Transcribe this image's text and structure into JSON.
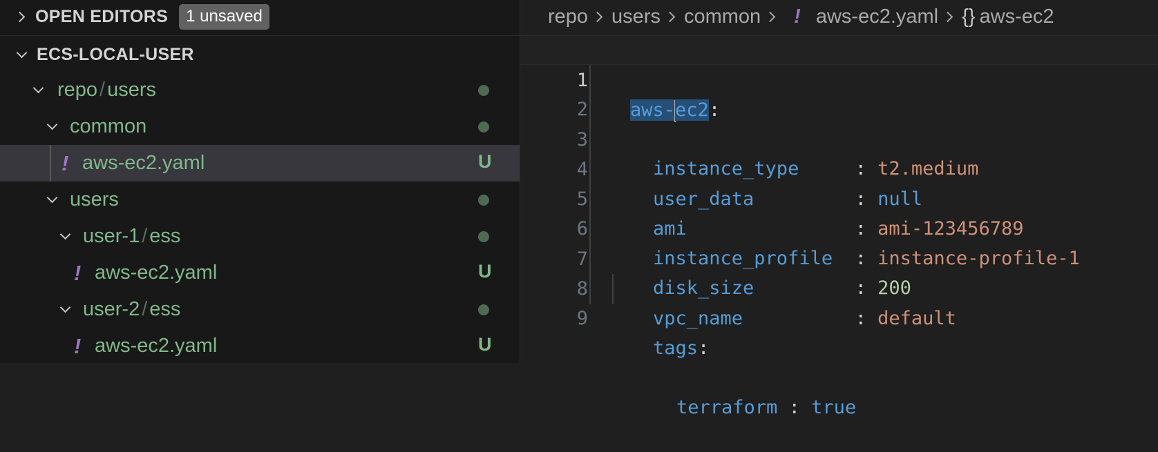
{
  "sidebar": {
    "open_editors_title": "OPEN EDITORS",
    "unsaved_badge": "1 unsaved",
    "workspace_title": "ECS-LOCAL-USER",
    "tree": [
      {
        "label_a": "repo",
        "label_b": "users",
        "kind": "folder",
        "status": "dot"
      },
      {
        "label": "common",
        "kind": "folder",
        "status": "dot"
      },
      {
        "label": "aws-ec2.yaml",
        "kind": "file",
        "icon": "!",
        "status": "U"
      },
      {
        "label": "users",
        "kind": "folder",
        "status": "dot"
      },
      {
        "label_a": "user-1",
        "label_b": "ess",
        "kind": "folder",
        "status": "dot"
      },
      {
        "label": "aws-ec2.yaml",
        "kind": "file",
        "icon": "!",
        "status": "U"
      },
      {
        "label_a": "user-2",
        "label_b": "ess",
        "kind": "folder",
        "status": "dot"
      },
      {
        "label": "aws-ec2.yaml",
        "kind": "file",
        "icon": "!",
        "status": "U"
      }
    ]
  },
  "breadcrumb": {
    "items": [
      "repo",
      "users",
      "common"
    ],
    "file_icon": "!",
    "file": "aws-ec2.yaml",
    "symbol_icon": "{}",
    "symbol": "aws-ec2"
  },
  "editor": {
    "line_numbers": [
      "1",
      "2",
      "3",
      "4",
      "5",
      "6",
      "7",
      "8",
      "9"
    ],
    "root_key_a": "aws-",
    "root_key_b": "ec2",
    "colon": ":",
    "entries": [
      {
        "key": "instance_type",
        "pad": "    ",
        "value": "t2.medium"
      },
      {
        "key": "user_data",
        "pad": "        ",
        "value": "null"
      },
      {
        "key": "ami",
        "pad": "              ",
        "value": "ami-123456789"
      },
      {
        "key": "instance_profile",
        "pad": " ",
        "value": "instance-profile-1"
      },
      {
        "key": "disk_size",
        "pad": "        ",
        "value": "200"
      },
      {
        "key": "vpc_name",
        "pad": "         ",
        "value": "default"
      }
    ],
    "tags_key": "tags",
    "tag": {
      "key": "terraform",
      "value": "true"
    }
  },
  "colors": {
    "sidebar_bg": "#181818",
    "editor_bg": "#1f1f1f",
    "git_untracked": "#81b88b",
    "yaml_icon": "#a074c4",
    "selection": "#37373d"
  }
}
